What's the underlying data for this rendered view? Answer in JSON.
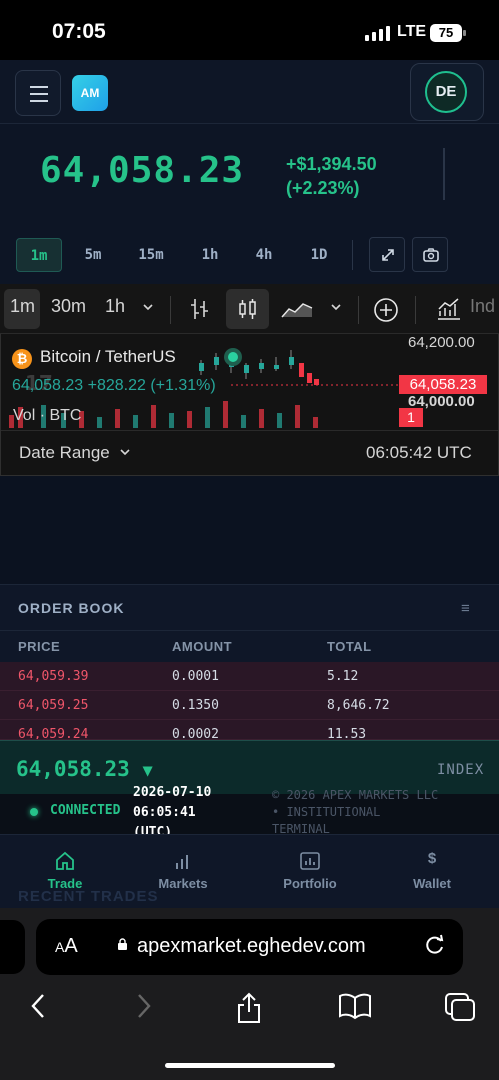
{
  "status_bar": {
    "time": "07:05",
    "network": "LTE",
    "battery": "75"
  },
  "header": {
    "logo": "AM",
    "avatar": "DE",
    "menu_icon": "hamburger-icon"
  },
  "ticker": {
    "price": "64,058.23",
    "change_abs": "+$1,394.50",
    "change_pct": "(+2.23%)"
  },
  "timeframes": {
    "options": [
      "1m",
      "5m",
      "15m",
      "1h",
      "4h",
      "1D"
    ],
    "active": "1m"
  },
  "tradingview": {
    "toolbar": {
      "tf1": "1m",
      "tf2": "30m",
      "tf3": "1h",
      "indicators": "Ind"
    },
    "symbol": "Bitcoin / TetherUS",
    "ohlc": "64,058.23 +828.22 (+1.31%)",
    "volume_label": "Vol · BTC",
    "axis_high": "64,200.00",
    "axis_price": "64,058.23",
    "axis_low": "64,000.00",
    "axis_badge": "1",
    "date_range": "Date Range",
    "time": "06:05:42 UTC"
  },
  "order_book": {
    "title": "ORDER BOOK",
    "columns": [
      "PRICE",
      "AMOUNT",
      "TOTAL"
    ],
    "asks": [
      {
        "price": "64,059.39",
        "amount": "0.0001",
        "total": "5.12"
      },
      {
        "price": "64,059.25",
        "amount": "0.1350",
        "total": "8,646.72"
      },
      {
        "price": "64,059.24",
        "amount": "0.0002",
        "total": "11.53"
      }
    ]
  },
  "index_bar": {
    "price": "64,058.23",
    "label": "INDEX"
  },
  "connection": {
    "status": "CONNECTED",
    "date": "2026-07-10",
    "time": "06:05:41",
    "tz": "(UTC)",
    "copyright_1": "© 2026 APEX MARKETS LLC",
    "copyright_2": "• INSTITUTIONAL",
    "copyright_3": "TERMINAL"
  },
  "bottom_nav": {
    "items": [
      "Trade",
      "Markets",
      "Portfolio",
      "Wallet"
    ],
    "active": "Trade",
    "ghost_heading": "RECENT TRADES"
  },
  "safari": {
    "aa": "AA",
    "url": "apexmarket.eghedev.com"
  },
  "colors": {
    "accent_green": "#26c28a",
    "ask_red": "#f0566a",
    "tv_red": "#f23645"
  }
}
